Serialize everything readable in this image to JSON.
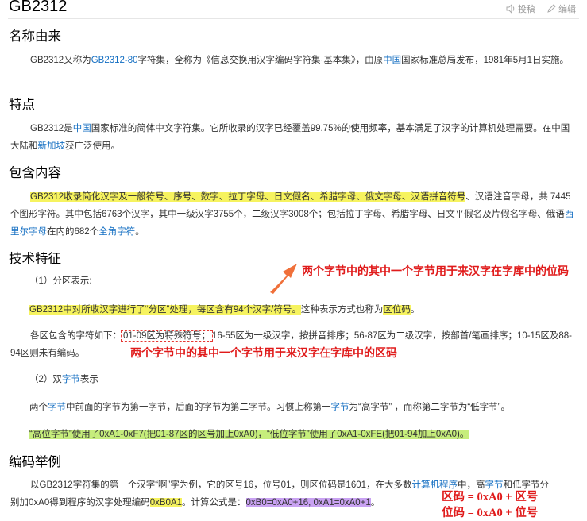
{
  "page": {
    "title": "GB2312",
    "toolbar": {
      "upload_label": "投稿",
      "edit_label": "编辑"
    }
  },
  "sections": {
    "name_origin": {
      "heading": "名称由来",
      "p1": [
        "GB2312又称为",
        "GB2312-80",
        "字符集，全称为《信息交换用汉字编码字符集·基本集》，由原",
        "中国",
        "国家标准总局发布，1981年5月1日实施。"
      ]
    },
    "features": {
      "heading": "特点",
      "p1": [
        "GB2312是",
        "中国",
        "国家标准的简体中文字符集。它所收录的汉字已经覆盖99.75%的使用频率，基本满足了汉字的计算机处理需要。在中国大陆和",
        "新加坡",
        "获广泛使用。"
      ]
    },
    "contents": {
      "heading": "包含内容",
      "p1": [
        "GB2312收录简化汉字及一般符号、序号、数字、拉丁字母、日文假名、希腊字母、俄文字母、汉语拼音符号",
        "、汉语注音字母，共 7445 个图形字符。其中包括6763个汉字，其中一级汉字3755个，二级汉字3008个；包括拉丁字母、希腊字母、日文平假名及片假名字母、俄语",
        "西里尔字母",
        "在内的682个",
        "全角字符",
        "。"
      ]
    },
    "tech": {
      "heading": "技术特征",
      "sub1": "（1）分区表示:",
      "p1": [
        "GB2312中对所收汉字进行了“分区”处理，每区含有94个汉字/符号。",
        "这种表示方式也称为",
        "区位码",
        "。"
      ],
      "p2": [
        "各区包含的字符如下：",
        "01-09区为特殊符号；",
        "16-55区为一级汉字，按拼音排序；56-87区为二级汉字，按部首/笔画排序；10-15区及88-94区则未有编码。"
      ],
      "sub2": [
        "（2）双",
        "字节",
        "表示"
      ],
      "p3": [
        "两个",
        "字节",
        "中前面的字节为第一字节，后面的字节为第二字节。习惯上称第一",
        "字节",
        "为“高字节” ，而称第二字节为“低字节”。"
      ],
      "p4": "“高位字节”使用了0xA1-0xF7(把01-87区的区号加上0xA0)，“低位字节”使用了0xA1-0xFE(把01-94加上0xA0)。"
    },
    "example": {
      "heading": "编码举例",
      "p1": [
        "以GB2312字符集的第一个汉字“啊”字为例，它的区号16，位号01，则区位码是1601，在大多数",
        "计算机程序",
        "中，高",
        "字节",
        "和低字节分别加0xA0得到程序的汉字处理编码",
        "0xB0A1",
        "。计算公式是：",
        "0xB0=0xA0+16, 0xA1=0xA0+1",
        "。"
      ]
    }
  },
  "annotations": {
    "arrow_note": "两个字节中的其中一个字节用于来汉字在字库中的位码",
    "area_note": "两个字节中的其中一个字节用于来汉字在字库中的区码",
    "formula1": "区码 = 0xA0 + 区号",
    "formula2": "位码 = 0xA0 + 位号",
    "accent_color": "#e01b1b",
    "arrow_color": "#f0703a"
  }
}
